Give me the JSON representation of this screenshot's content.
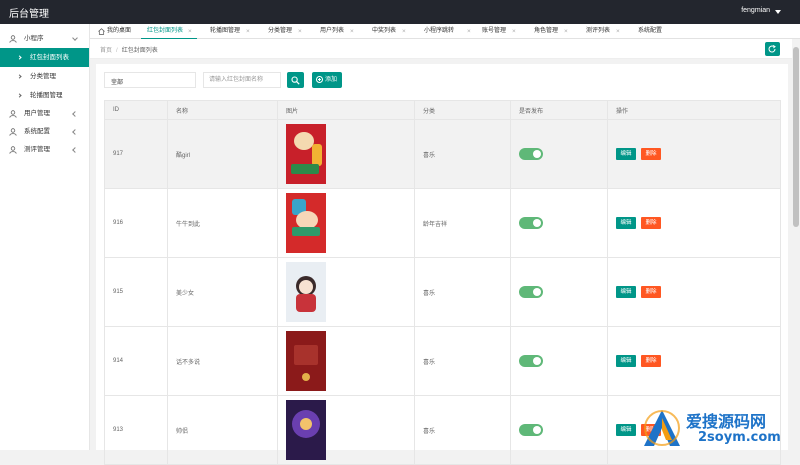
{
  "header": {
    "title": "后台管理",
    "user": "fengmian"
  },
  "sidebar": {
    "groups": [
      {
        "label": "小程序",
        "icon": "user-icon",
        "expanded": true,
        "items": [
          {
            "label": "红包封面列表",
            "active": true
          },
          {
            "label": "分类管理",
            "active": false
          },
          {
            "label": "轮播图管理",
            "active": false
          }
        ]
      },
      {
        "label": "用户管理",
        "icon": "user-icon",
        "expanded": false
      },
      {
        "label": "系统配置",
        "icon": "user-icon",
        "expanded": false
      },
      {
        "label": "测评管理",
        "icon": "user-icon",
        "expanded": false
      }
    ]
  },
  "tabs": [
    {
      "label": "我的桌面",
      "home": true
    },
    {
      "label": "红包封面列表",
      "active": true
    },
    {
      "label": "轮播图管理"
    },
    {
      "label": "分类管理"
    },
    {
      "label": "用户列表"
    },
    {
      "label": "中奖列表"
    },
    {
      "label": "小程序跳转"
    },
    {
      "label": "账号管理"
    },
    {
      "label": "角色管理"
    },
    {
      "label": "测评列表"
    },
    {
      "label": "系统配置"
    }
  ],
  "breadcrumb": {
    "home": "首页",
    "separator": "/",
    "current": "红包封面列表"
  },
  "toolbar": {
    "select_value": "全部",
    "search_placeholder": "请输入红包封面名称",
    "add_label": "添加"
  },
  "table": {
    "columns": [
      "ID",
      "名称",
      "图片",
      "分类",
      "是否发布",
      "操作"
    ],
    "rows": [
      {
        "id": "917",
        "name": "酷girl",
        "thumb": "red",
        "category": "喜乐",
        "published": true
      },
      {
        "id": "916",
        "name": "牛牛到此",
        "thumb": "red2",
        "category": "龄年吉祥",
        "published": true
      },
      {
        "id": "915",
        "name": "美少女",
        "thumb": "light",
        "category": "喜乐",
        "published": true
      },
      {
        "id": "914",
        "name": "话不多说",
        "thumb": "dark",
        "category": "喜乐",
        "published": true
      },
      {
        "id": "913",
        "name": "帅侣",
        "thumb": "purple",
        "category": "喜乐",
        "published": true
      }
    ],
    "edit_label": "编辑",
    "delete_label": "删除"
  },
  "watermark": {
    "line1": "爱搜源码网",
    "line2": "2soym.com"
  }
}
